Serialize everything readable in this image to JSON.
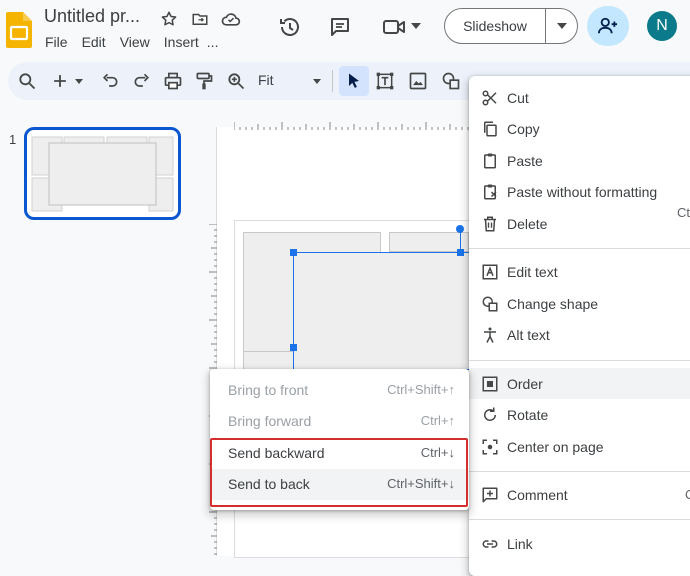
{
  "header": {
    "title": "Untitled pr...",
    "menu": [
      "File",
      "Edit",
      "View",
      "Insert",
      "..."
    ],
    "slideshow_label": "Slideshow",
    "avatar_initial": "N"
  },
  "toolbar": {
    "zoom_label": "Fit"
  },
  "filmstrip": {
    "slide_number": "1"
  },
  "context_menu": {
    "items": [
      {
        "label": "Cut",
        "icon": "scissors-icon"
      },
      {
        "label": "Copy",
        "icon": "copy-icon"
      },
      {
        "label": "Paste",
        "icon": "clipboard-icon"
      },
      {
        "label": "Paste without formatting",
        "icon": "clipboard-plain-icon"
      },
      {
        "label": "Delete",
        "icon": "trash-icon"
      },
      {
        "label": "Edit text",
        "icon": "text-box-icon"
      },
      {
        "label": "Change shape",
        "icon": "shapes-icon"
      },
      {
        "label": "Alt text",
        "icon": "accessibility-icon"
      },
      {
        "label": "Order",
        "icon": "order-icon"
      },
      {
        "label": "Rotate",
        "icon": "rotate-icon"
      },
      {
        "label": "Center on page",
        "icon": "center-icon"
      },
      {
        "label": "Comment",
        "icon": "comment-add-icon"
      },
      {
        "label": "Link",
        "icon": "link-icon"
      }
    ],
    "clipped_shortcut": "Ct",
    "comment_shortcut": "C"
  },
  "order_submenu": {
    "items": [
      {
        "label": "Bring to front",
        "shortcut": "Ctrl+Shift+↑",
        "enabled": false
      },
      {
        "label": "Bring forward",
        "shortcut": "Ctrl+↑",
        "enabled": false
      },
      {
        "label": "Send backward",
        "shortcut": "Ctrl+↓",
        "enabled": true
      },
      {
        "label": "Send to back",
        "shortcut": "Ctrl+Shift+↓",
        "enabled": true
      }
    ]
  },
  "colors": {
    "accent": "#0b57d0",
    "highlight_box": "#d32f2f",
    "slides_yellow": "#f4b400"
  }
}
